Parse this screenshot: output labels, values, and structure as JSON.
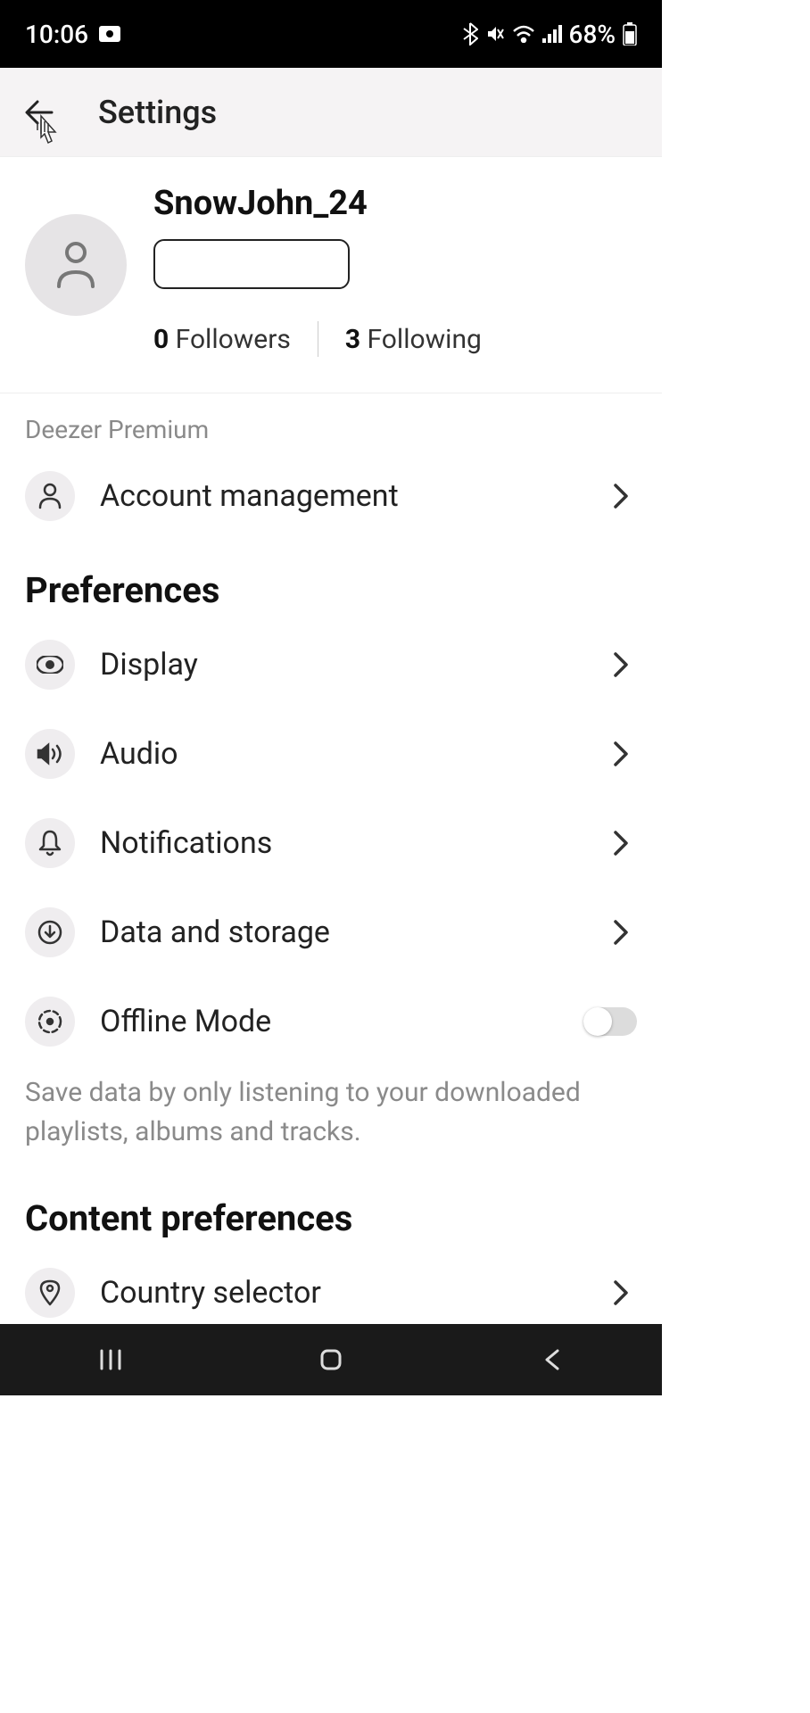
{
  "status": {
    "time": "10:06",
    "battery": "68%"
  },
  "header": {
    "title": "Settings"
  },
  "profile": {
    "username": "SnowJohn_24",
    "followers_count": "0",
    "followers_label": "Followers",
    "following_count": "3",
    "following_label": "Following"
  },
  "subscription": {
    "label": "Deezer Premium",
    "account_management": "Account management"
  },
  "preferences": {
    "header": "Preferences",
    "display": "Display",
    "audio": "Audio",
    "notifications": "Notifications",
    "data_storage": "Data and storage",
    "offline_mode": "Offline Mode",
    "offline_description": "Save data by only listening to your downloaded playlists, albums and tracks."
  },
  "content_prefs": {
    "header": "Content preferences",
    "country_selector": "Country selector"
  }
}
